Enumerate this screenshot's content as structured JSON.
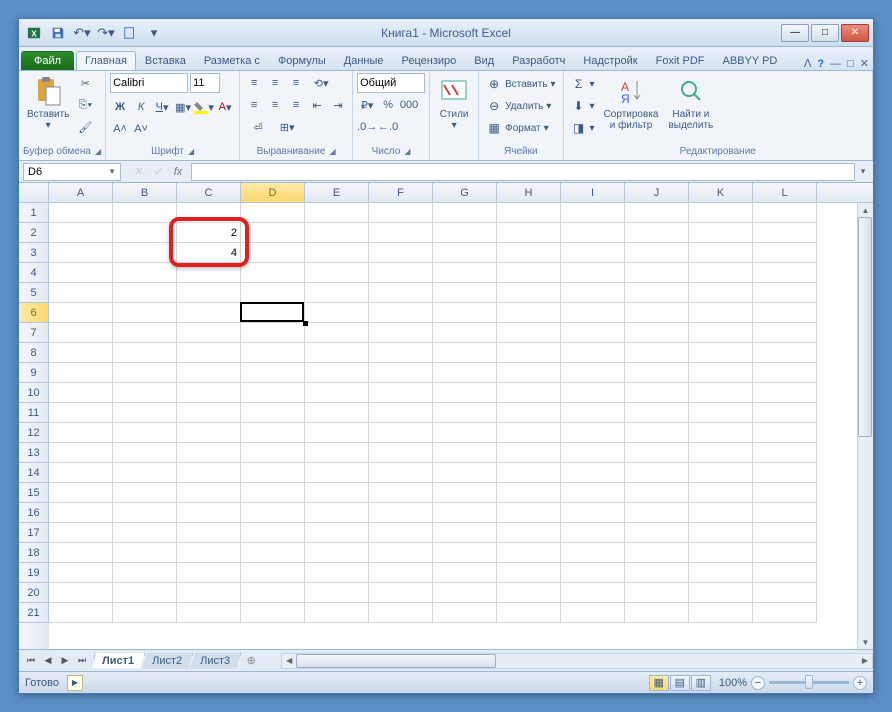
{
  "title": "Книга1 - Microsoft Excel",
  "tabs": {
    "file": "Файл",
    "list": [
      "Главная",
      "Вставка",
      "Разметка с",
      "Формулы",
      "Данные",
      "Рецензиро",
      "Вид",
      "Разработч",
      "Надстройк",
      "Foxit PDF",
      "ABBYY PD"
    ],
    "active": 0
  },
  "ribbon": {
    "clipboard": {
      "paste": "Вставить",
      "label": "Буфер обмена"
    },
    "font": {
      "name": "Calibri",
      "size": "11",
      "label": "Шрифт"
    },
    "alignment": {
      "label": "Выравнивание"
    },
    "number": {
      "format": "Общий",
      "label": "Число"
    },
    "styles": {
      "btn": "Стили",
      "label": ""
    },
    "cells": {
      "insert": "Вставить",
      "delete": "Удалить",
      "format": "Формат",
      "label": "Ячейки"
    },
    "editing": {
      "sort": "Сортировка\nи фильтр",
      "find": "Найти и\nвыделить",
      "label": "Редактирование"
    }
  },
  "formula_bar": {
    "name_box": "D6",
    "fx": "fx",
    "value": ""
  },
  "columns": [
    "A",
    "B",
    "C",
    "D",
    "E",
    "F",
    "G",
    "H",
    "I",
    "J",
    "K",
    "L"
  ],
  "rows": [
    "1",
    "2",
    "3",
    "4",
    "5",
    "6",
    "7",
    "8",
    "9",
    "10",
    "11",
    "12",
    "13",
    "14",
    "15",
    "16",
    "17",
    "18",
    "19",
    "20",
    "21"
  ],
  "selected": {
    "col": "D",
    "row": "6"
  },
  "cell_data": {
    "C2": "2",
    "C3": "4"
  },
  "sheets": {
    "list": [
      "Лист1",
      "Лист2",
      "Лист3"
    ],
    "active": 0
  },
  "status": {
    "text": "Готово",
    "zoom": "100%"
  }
}
